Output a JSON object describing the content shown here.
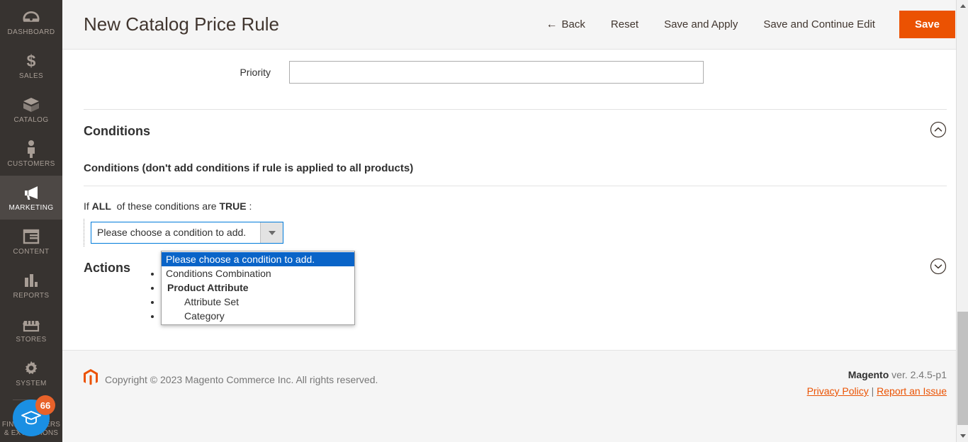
{
  "sidebar": {
    "items": [
      {
        "label": "DASHBOARD",
        "icon": "dashboard-gauge-icon",
        "active": false
      },
      {
        "label": "SALES",
        "icon": "dollar-sign-icon",
        "active": false
      },
      {
        "label": "CATALOG",
        "icon": "box-icon",
        "active": false
      },
      {
        "label": "CUSTOMERS",
        "icon": "person-icon",
        "active": false
      },
      {
        "label": "MARKETING",
        "icon": "megaphone-icon",
        "active": true
      },
      {
        "label": "CONTENT",
        "icon": "layout-window-icon",
        "active": false
      },
      {
        "label": "REPORTS",
        "icon": "bar-chart-icon",
        "active": false
      },
      {
        "label": "STORES",
        "icon": "storefront-icon",
        "active": false
      },
      {
        "label": "SYSTEM",
        "icon": "gear-icon",
        "active": false
      }
    ],
    "education": {
      "label_line1": "FIND PARTNERS",
      "label_line2": "& EXTENSIONS",
      "badge_count": "66",
      "icon": "graduation-cap-icon"
    }
  },
  "header": {
    "title": "New Catalog Price Rule",
    "back_label": "Back",
    "back_icon": "arrow-left-icon",
    "reset_label": "Reset",
    "save_and_apply_label": "Save and Apply",
    "save_and_continue_label": "Save and Continue Edit",
    "save_label": "Save",
    "save_color": "#eb5202"
  },
  "form": {
    "priority": {
      "label": "Priority",
      "value": "",
      "placeholder": ""
    }
  },
  "conditions_section": {
    "title": "Conditions",
    "toggle_icon": "chevron-up-circle-icon",
    "expanded": true,
    "subtitle": "Conditions (don't add conditions if rule is applied to all products)",
    "rule_prefix": "If",
    "rule_aggregator": "ALL",
    "rule_middle": "of these conditions are",
    "rule_value": "TRUE",
    "rule_suffix": ":",
    "select": {
      "selected_value": "Please choose a condition to add.",
      "caret_icon": "chevron-down-icon",
      "open": true,
      "options": [
        {
          "label": "Please choose a condition to add.",
          "type": "option",
          "selected": true
        },
        {
          "label": "Conditions Combination",
          "type": "option",
          "selected": false
        },
        {
          "label": "Product Attribute",
          "type": "group",
          "selected": false
        },
        {
          "label": "Attribute Set",
          "type": "child",
          "selected": false
        },
        {
          "label": "Category",
          "type": "child",
          "selected": false
        }
      ],
      "highlight_color": "#0a64c8",
      "border_color": "#007bdb"
    }
  },
  "actions_section": {
    "title": "Actions",
    "toggle_icon": "chevron-down-circle-icon",
    "expanded": false
  },
  "footer": {
    "logo_icon": "magento-logo-icon",
    "copyright": "Copyright © 2023 Magento Commerce Inc. All rights reserved.",
    "brand": "Magento",
    "version": "ver. 2.4.5-p1",
    "privacy_policy": "Privacy Policy",
    "separator": "|",
    "report_issue": "Report an Issue"
  },
  "scrollbar": {
    "up_icon": "triangle-up-icon",
    "down_icon": "triangle-down-icon"
  }
}
